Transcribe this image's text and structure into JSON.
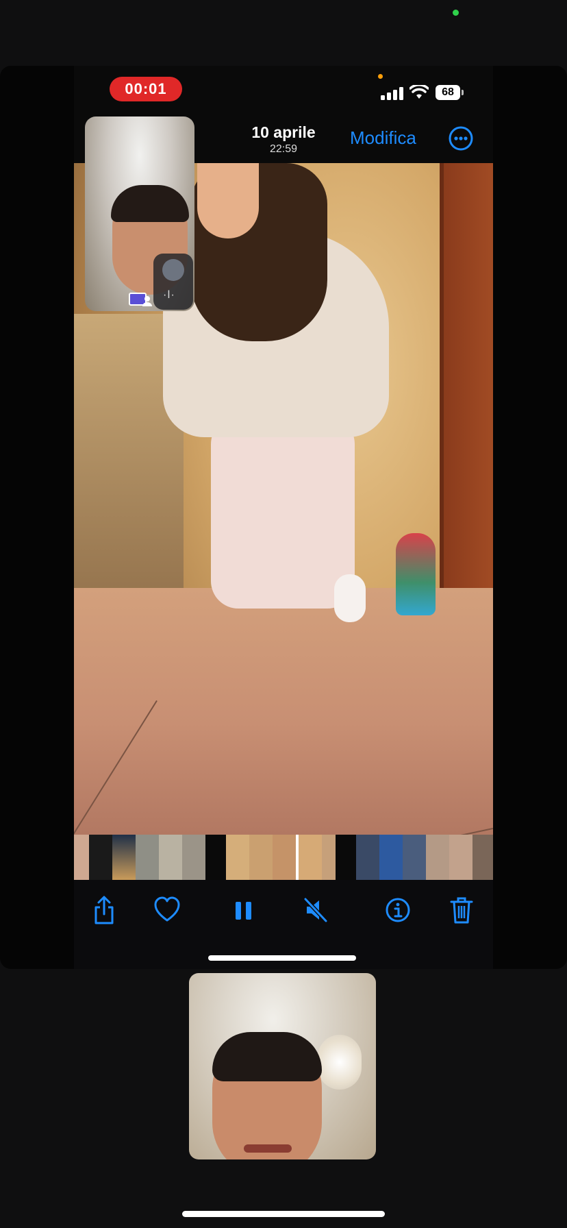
{
  "status_bar": {
    "call_timer": "00:01",
    "battery": "68"
  },
  "header": {
    "date": "10 aprile",
    "time": "22:59",
    "edit_label": "Modifica"
  },
  "toolbar": {
    "icons": [
      "share-icon",
      "heart-icon",
      "pause-icon",
      "speaker-muted-icon",
      "info-icon",
      "trash-icon"
    ]
  },
  "colors": {
    "accent": "#1e8cff",
    "recording": "#e02828",
    "camera_indicator": "#2fd14b",
    "mic_indicator": "#ff9f0a"
  }
}
